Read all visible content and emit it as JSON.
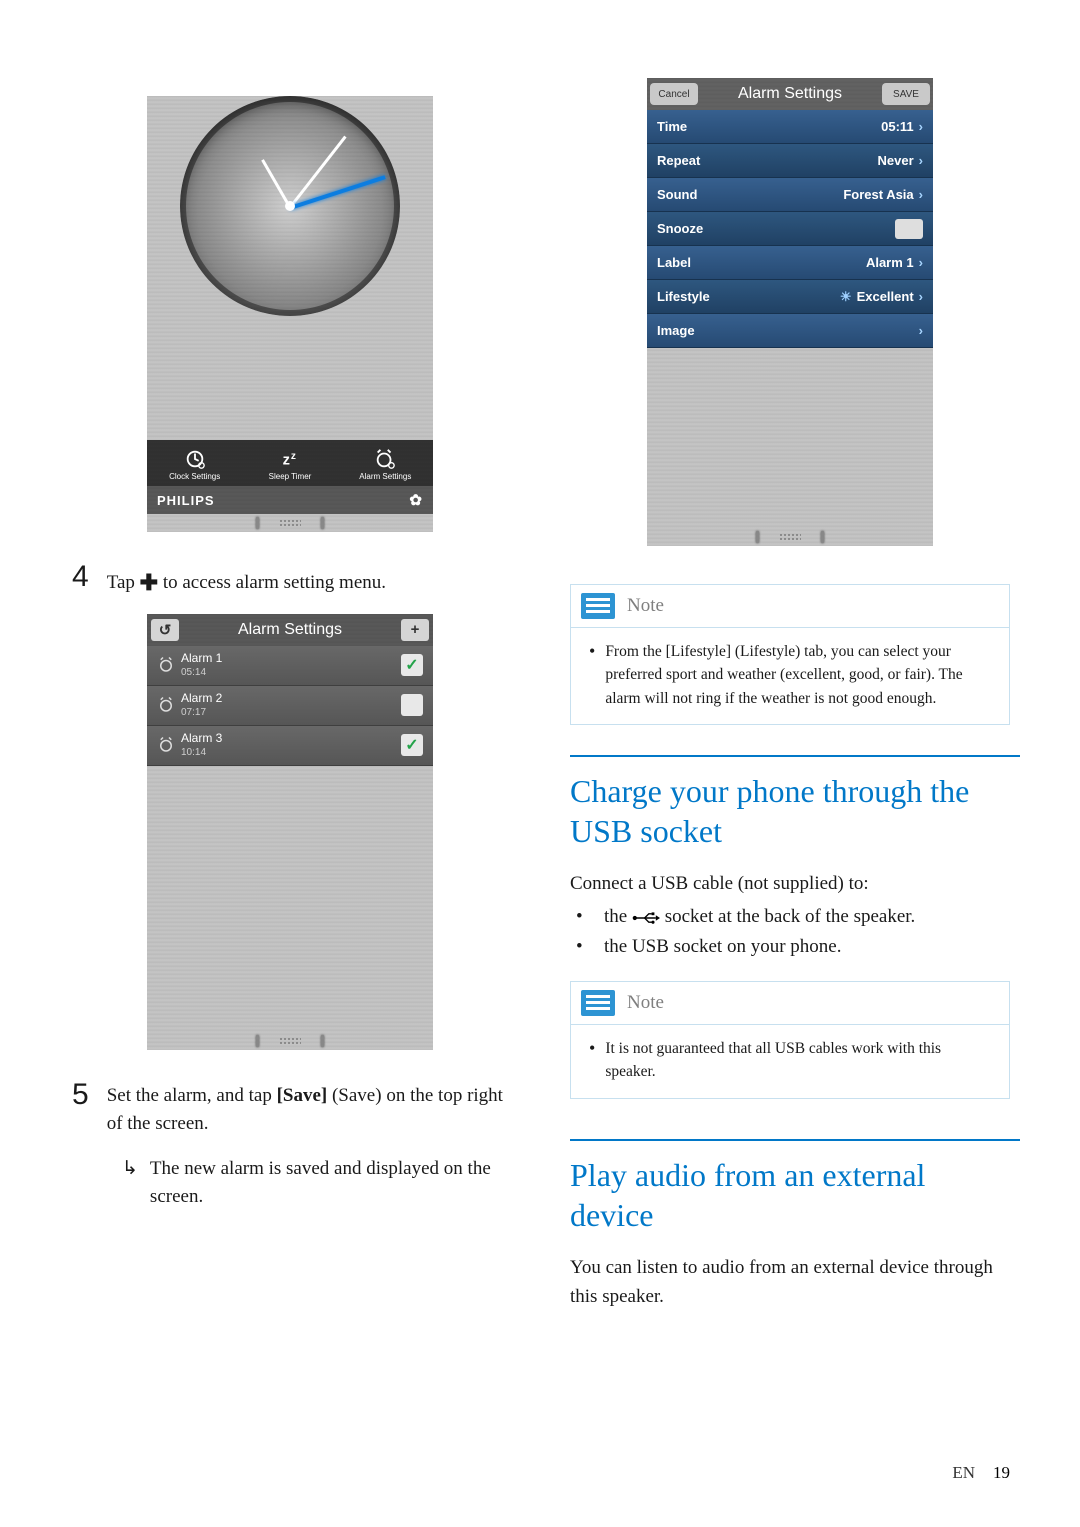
{
  "footer": {
    "lang": "EN",
    "page": "19"
  },
  "step4": {
    "num": "4",
    "text_before": "Tap ",
    "plus": "✚",
    "text_after": " to access alarm setting menu."
  },
  "step5": {
    "num": "5",
    "text_a": "Set the alarm, and tap ",
    "bold": "[Save]",
    "text_b": " (Save) on the top right of the screen.",
    "arrow": "↳",
    "result": "The new alarm is saved and displayed on the screen."
  },
  "clock_shot": {
    "toolbar": [
      {
        "id": "clock-settings",
        "label": "Clock Settings"
      },
      {
        "id": "sleep-timer",
        "label": "Sleep Timer"
      },
      {
        "id": "alarm-settings",
        "label": "Alarm Settings"
      }
    ],
    "brand": "PHILIPS"
  },
  "alarm_list_shot": {
    "title": "Alarm Settings",
    "back": "↺",
    "add": "+",
    "rows": [
      {
        "name": "Alarm 1",
        "time": "05:14",
        "on": true
      },
      {
        "name": "Alarm 2",
        "time": "07:17",
        "on": false
      },
      {
        "name": "Alarm 3",
        "time": "10:14",
        "on": true
      }
    ]
  },
  "settings_shot": {
    "cancel": "Cancel",
    "title": "Alarm Settings",
    "save": "SAVE",
    "rows": {
      "Time": "05:11",
      "Repeat": "Never",
      "Sound": "Forest Asia",
      "Snooze": "",
      "Label": "Alarm 1",
      "Lifestyle": "Excellent",
      "Image": ""
    }
  },
  "note1": {
    "label": "Note",
    "text": "From the [Lifestyle] (Lifestyle) tab, you can select your preferred sport and weather (excellent, good, or fair). The alarm will not ring if the weather is not good enough."
  },
  "heading_usb": "Charge your phone through the USB socket",
  "usb_intro": "Connect a USB cable (not supplied) to:",
  "usb_bullets": {
    "b1_before": "the ",
    "b1_after": " socket at the back of the speaker.",
    "b2": "the USB socket on your phone."
  },
  "note2": {
    "label": "Note",
    "text": "It is not guaranteed that all USB cables work with this speaker."
  },
  "heading_ext": "Play audio from an external device",
  "ext_p": "You can listen to audio from an external device through this speaker."
}
